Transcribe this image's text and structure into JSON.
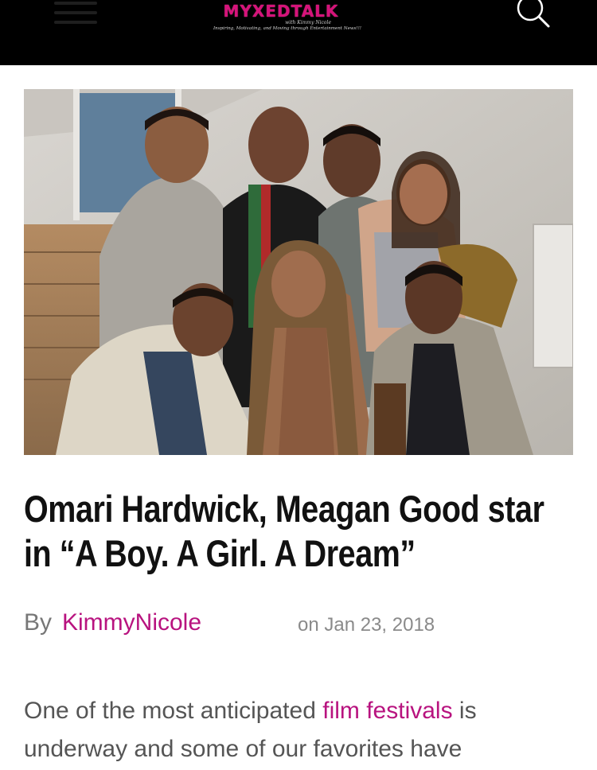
{
  "header": {
    "logo_text": "MYXEDTALK",
    "logo_subtitle": "with Kimmy Nicole",
    "logo_tagline": "Inspiring, Motivating, and Moving through Entertainment News!!!",
    "menu_icon": "hamburger-menu-icon",
    "search_icon": "search-icon",
    "background_color": "#000000",
    "brand_color": "#d6127a"
  },
  "article": {
    "hero_image": "group-photo",
    "title": "Omari Hardwick, Meagan Good star in “A Boy. A Girl. A Dream”",
    "by_label": "By",
    "author": "KimmyNicole",
    "date": "on Jan 23, 2018",
    "body_prefix": "One of the most anticipated ",
    "body_link": "film festivals",
    "body_suffix": " is underway and some of our favorites have",
    "link_color": "#b8137f"
  }
}
